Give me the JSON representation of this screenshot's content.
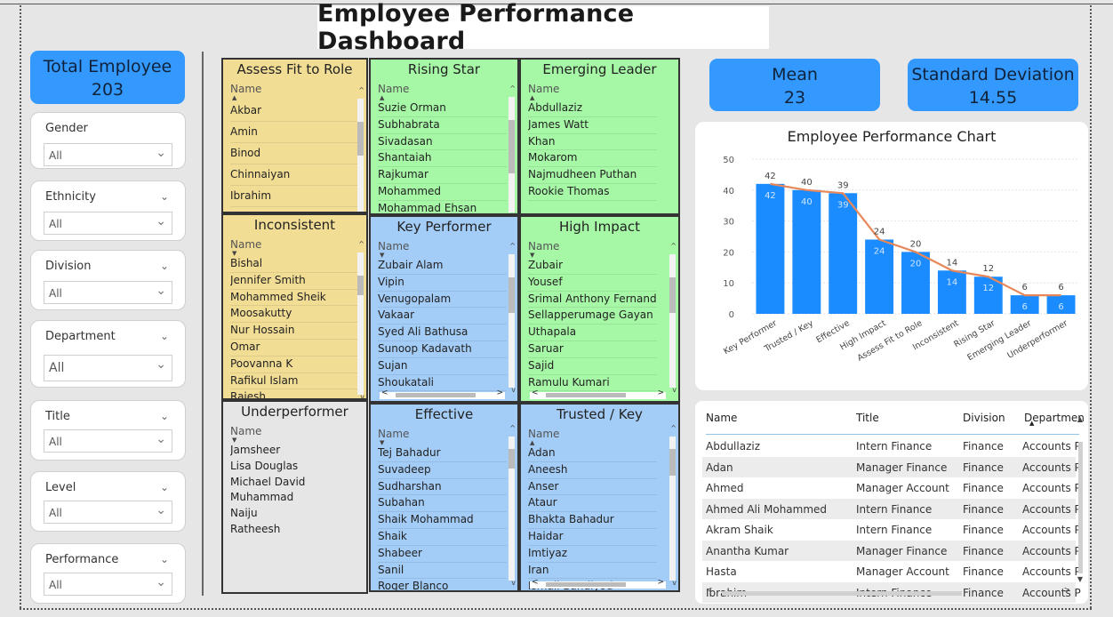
{
  "dashboard_title": "Employee Performance Dashboard",
  "kpis": {
    "total_employee_label": "Total Employee",
    "total_employee_value": "203",
    "mean_label": "Mean",
    "mean_value": "23",
    "std_label": "Standard Deviation",
    "std_value": "14.55"
  },
  "slicers": [
    {
      "label": "Gender",
      "value": "All"
    },
    {
      "label": "Ethnicity",
      "value": "All"
    },
    {
      "label": "Division",
      "value": "All"
    },
    {
      "label": "Department",
      "value": "All"
    },
    {
      "label": "Title",
      "value": "All"
    },
    {
      "label": "Level",
      "value": "All"
    },
    {
      "label": "Performance",
      "value": "All"
    }
  ],
  "panels": {
    "assess": {
      "title": "Assess Fit to Role",
      "col": "Name",
      "rows": [
        "Akbar",
        "Amin",
        "Binod",
        "Chinnaiyan",
        "Ibrahim"
      ]
    },
    "rising": {
      "title": "Rising Star",
      "col": "Name",
      "rows": [
        "Suzie Orman",
        "Subhabrata",
        "Sivadasan",
        "Shantaiah",
        "Rajkumar",
        "Mohammed",
        "Mohammad Ehsan"
      ]
    },
    "emerging": {
      "title": "Emerging Leader",
      "col": "Name",
      "rows": [
        "Abdullaziz",
        "James Watt",
        "Khan",
        "Mokarom",
        "Najmudheen Puthan",
        "Rookie Thomas"
      ]
    },
    "inconsistent": {
      "title": "Inconsistent",
      "col": "Name",
      "rows": [
        "Bishal",
        "Jennifer Smith",
        "Mohammed Sheik",
        "Moosakutty",
        "Nur Hossain",
        "Omar",
        "Poovanna K",
        "Rafikul Islam",
        "Rajesh"
      ]
    },
    "key": {
      "title": "Key Performer",
      "col": "Name",
      "rows": [
        "Zubair Alam",
        "Vipin",
        "Venugopalam",
        "Vakaar",
        "Syed Ali Bathusa",
        "Sunoop Kadavath",
        "Sujan",
        "Shoukatali"
      ]
    },
    "high": {
      "title": "High Impact",
      "col": "Name",
      "rows": [
        "Zubair",
        "Yousef",
        "Srimal Anthony Fernando",
        "Sellapperumage Gayan",
        "Uthapala",
        "Saruar",
        "Sajid",
        "Ramulu Kumari"
      ]
    },
    "under": {
      "title": "Underperformer",
      "col": "Name",
      "rows": [
        "Jamsheer",
        "Lisa Douglas",
        "Michael David",
        "Muhammad",
        "Naiju",
        "Ratheesh"
      ]
    },
    "effective": {
      "title": "Effective",
      "col": "Name",
      "rows": [
        "Tej Bahadur",
        "Suvadeep",
        "Sudharshan",
        "Subahan",
        "Shaik Mohammad",
        "Shaik",
        "Shabeer",
        "Sanil",
        "Roger Blanco"
      ]
    },
    "trusted": {
      "title": "Trusted / Key",
      "col": "Name",
      "rows": [
        "Adan",
        "Aneesh",
        "Anser",
        "Ataur",
        "Bhakta Bahadur",
        "Haidar",
        "Imtiyaz",
        "Iran",
        "Ismail Bandiyod"
      ]
    }
  },
  "chart_data": {
    "type": "bar",
    "title": "Employee Performance Chart",
    "categories": [
      "Key Performer",
      "Trusted / Key",
      "Effective",
      "High Impact",
      "Assess Fit to Role",
      "Inconsistent",
      "Rising Star",
      "Emerging Leader",
      "Underperformer"
    ],
    "values": [
      42,
      40,
      39,
      24,
      20,
      14,
      12,
      6,
      6
    ],
    "line_values": [
      42,
      40,
      39,
      24,
      20,
      14,
      12,
      6,
      6
    ],
    "yticks": [
      "0",
      "10",
      "20",
      "30",
      "40",
      "50"
    ],
    "ylim": [
      0,
      50
    ],
    "grid": true,
    "colors": {
      "bar": "#1a8cff",
      "line": "#e8875a"
    }
  },
  "table": {
    "headers": [
      "Name",
      "Title",
      "Division",
      "Departmen"
    ],
    "rows": [
      [
        "Abdullaziz",
        "Intern Finance",
        "Finance",
        "Accounts P"
      ],
      [
        "Adan",
        "Manager Finance",
        "Finance",
        "Accounts P"
      ],
      [
        "Ahmed",
        "Manager Account",
        "Finance",
        "Accounts P"
      ],
      [
        "Ahmed Ali Mohammed",
        "Intern Finance",
        "Finance",
        "Accounts P"
      ],
      [
        "Akram Shaik",
        "Intern Finance",
        "Finance",
        "Accounts P"
      ],
      [
        "Anantha Kumar",
        "Manager Finance",
        "Finance",
        "Accounts P"
      ],
      [
        "Hasta",
        "Manager Account",
        "Finance",
        "Accounts P"
      ],
      [
        "Ibrahim",
        "Intern Finance",
        "Finance",
        "Accounts P"
      ]
    ]
  }
}
